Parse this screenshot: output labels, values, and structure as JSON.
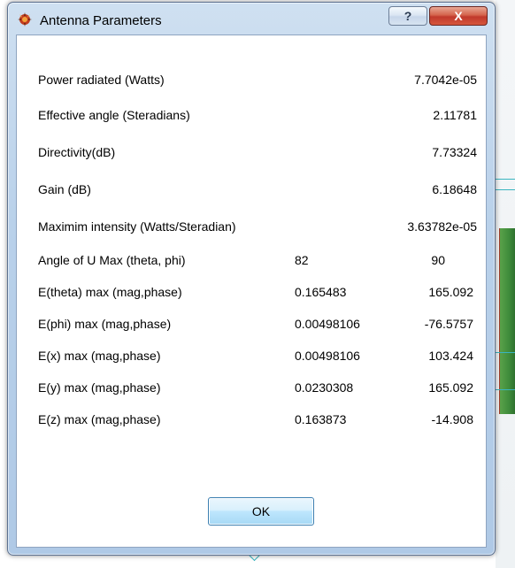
{
  "window": {
    "title": "Antenna Parameters",
    "help_label": "?",
    "close_label": "X"
  },
  "params": [
    {
      "label": "Power radiated (Watts)",
      "value": "7.7042e-05"
    },
    {
      "label": "Effective angle (Steradians)",
      "value": "2.11781"
    },
    {
      "label": "Directivity(dB)",
      "value": "7.73324"
    },
    {
      "label": "Gain (dB)",
      "value": "6.18648"
    },
    {
      "label": "Maximim intensity (Watts/Steradian)",
      "value": "3.63782e-05"
    }
  ],
  "pairs": [
    {
      "label": "Angle of U Max (theta, phi)",
      "a": "82",
      "b": "90"
    },
    {
      "label": "E(theta) max (mag,phase)",
      "a": "0.165483",
      "b": "165.092"
    },
    {
      "label": "E(phi) max (mag,phase)",
      "a": "0.00498106",
      "b": "-76.5757"
    },
    {
      "label": "E(x) max (mag,phase)",
      "a": "0.00498106",
      "b": "103.424"
    },
    {
      "label": "E(y) max (mag,phase)",
      "a": "0.0230308",
      "b": "165.092"
    },
    {
      "label": "E(z) max (mag,phase)",
      "a": "0.163873",
      "b": "-14.908"
    }
  ],
  "ok_label": "OK"
}
